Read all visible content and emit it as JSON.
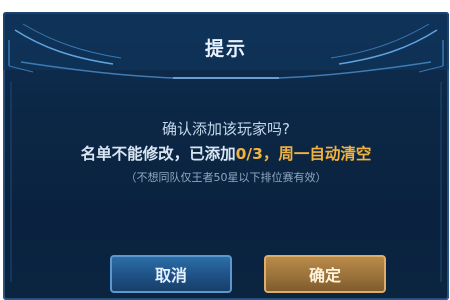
{
  "dialog": {
    "title": "提示",
    "message": {
      "question": "确认添加该玩家吗?",
      "note_prefix": "名单不能修改，已添加",
      "count": "0/3",
      "note_suffix": "，周一自动清空",
      "condition": "（不想同队仅王者50星以下排位赛有效）"
    },
    "buttons": {
      "cancel": "取消",
      "confirm": "确定"
    }
  },
  "colors": {
    "panel_dark": "#0b2440",
    "panel_edge": "#2a5684",
    "title_text": "#e8f3ff",
    "highlight": "#f2b33c",
    "cancel_button": "#1d4f82",
    "confirm_button": "#98703a"
  },
  "icons": [
    "frame-ornament-left",
    "frame-ornament-right"
  ]
}
